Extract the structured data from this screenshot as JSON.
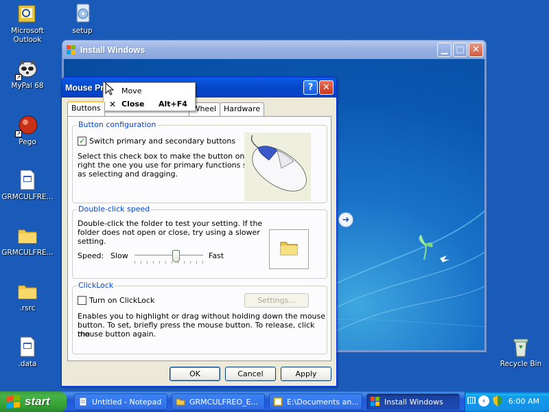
{
  "desktop": {
    "icons": [
      {
        "label": "Microsoft\nOutlook",
        "l1": "Microsoft",
        "l2": "Outlook"
      },
      {
        "label": "setup"
      },
      {
        "label": "MyPal 68"
      },
      {
        "label": "Pego"
      },
      {
        "label": "GRMCULFRE..."
      },
      {
        "label": "GRMCULFRE..."
      },
      {
        "label": ".rsrc"
      },
      {
        "label": ".data"
      },
      {
        "label": "Recycle Bin"
      }
    ]
  },
  "install_window": {
    "title": "Install Windows"
  },
  "dialog": {
    "title": "Mouse Pr",
    "tabs": [
      "Buttons",
      "Wheel",
      "Hardware"
    ],
    "button_config": {
      "group_title": "Button configuration",
      "checkbox_label": "Switch primary and secondary buttons",
      "checked": true,
      "desc1": "Select this check box to make the button on the",
      "desc2": "right the one you use for primary functions such",
      "desc3": "as selecting and dragging."
    },
    "double_click": {
      "group_title": "Double-click speed",
      "desc1": "Double-click the folder to test your setting. If the",
      "desc2": "folder does not open or close, try using a slower",
      "desc3": "setting.",
      "speed_label": "Speed:",
      "slow_label": "Slow",
      "fast_label": "Fast",
      "speed_value": 0.6
    },
    "clicklock": {
      "group_title": "ClickLock",
      "checkbox_label": "Turn on ClickLock",
      "checked": false,
      "settings_label": "Settings...",
      "desc1": "Enables you to highlight or drag without holding down the mouse",
      "desc2": "button. To set, briefly press the mouse button. To release, click the",
      "desc3": "mouse button again."
    },
    "ok_label": "OK",
    "cancel_label": "Cancel",
    "apply_label": "Apply"
  },
  "context_menu": {
    "items": [
      {
        "label": "Move",
        "shortcut": ""
      },
      {
        "label": "Close",
        "shortcut": "Alt+F4",
        "icon": "close-x-icon"
      }
    ]
  },
  "taskbar": {
    "start_label": "start",
    "buttons": [
      {
        "label": "Untitled - Notepad",
        "icon": "notepad-icon"
      },
      {
        "label": "GRMCULFREO_E...",
        "icon": "folder-icon"
      },
      {
        "label": "E:\\Documents an...",
        "icon": "document-icon"
      },
      {
        "label": "Install Windows",
        "icon": "windows-flag-icon",
        "active": true
      }
    ],
    "clock": "6:00 AM"
  },
  "colors": {
    "desktop": "#1a5ab8",
    "xp_title_blue": "#0547c8",
    "start_green": "#36a136"
  }
}
